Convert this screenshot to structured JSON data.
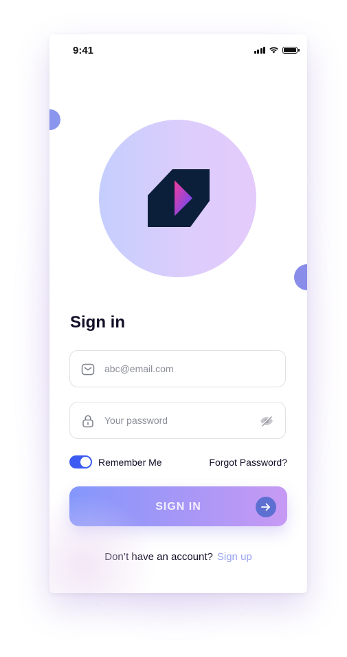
{
  "status_bar": {
    "time": "9:41",
    "icons": [
      "signal-icon",
      "wifi-icon",
      "battery-icon"
    ]
  },
  "logo": {
    "icon": "app-logo",
    "colors": [
      "#0b1f3b",
      "#f03fa4",
      "#6b4cff"
    ]
  },
  "title": "Sign in",
  "email_field": {
    "placeholder": "abc@email.com",
    "value": "",
    "icon": "mail-icon"
  },
  "password_field": {
    "placeholder": "Your password",
    "value": "",
    "icon": "lock-icon",
    "toggle_icon": "eye-off-icon"
  },
  "remember_me": {
    "label": "Remember Me",
    "checked": true
  },
  "forgot_password": "Forgot Password?",
  "sign_in_button": {
    "label": "SIGN IN",
    "icon": "arrow-right-icon"
  },
  "footer": {
    "question": "Don’t have an account?",
    "link": "Sign up"
  },
  "colors": {
    "accent": "#3b5bf3",
    "button_start": "#8497fc",
    "button_end": "#c79af4",
    "link": "#98a2f2",
    "text": "#120d26"
  }
}
